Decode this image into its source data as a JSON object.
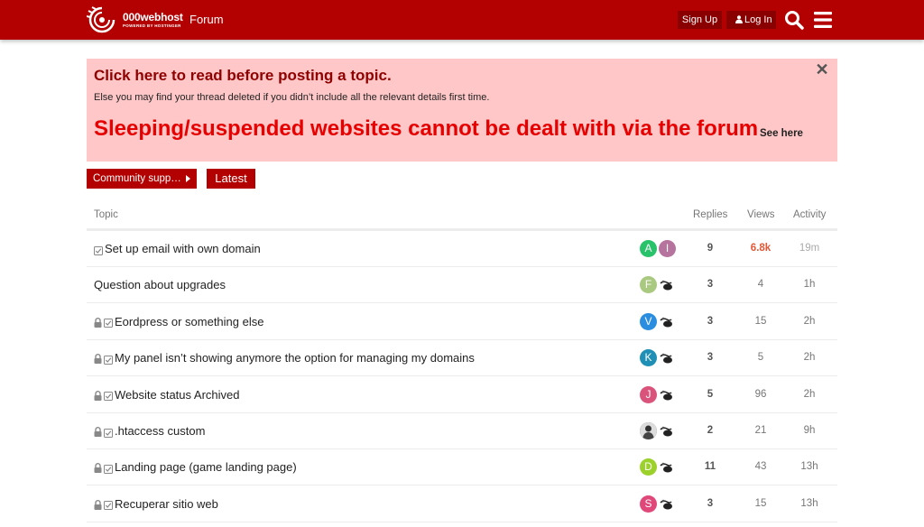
{
  "header": {
    "logo_name": "000webhost",
    "logo_tagline": "POWERED BY HOSTINGER",
    "forum_title": "Forum",
    "signup_label": "Sign Up",
    "login_label": "Log In",
    "brand_color": "#b30000"
  },
  "banner": {
    "title": "Click here to read before posting a topic.",
    "subtitle": "Else you may find your thread deleted if you didn’t include all the relevant details first time.",
    "headline": "Sleeping/suspended websites cannot be dealt with via the forum",
    "link": "See here",
    "close": "✕",
    "background": "#ffc7c7"
  },
  "filters": {
    "category": "Community supp…",
    "latest": "Latest"
  },
  "table": {
    "columns": [
      "Topic",
      "Replies",
      "Views",
      "Activity"
    ],
    "rows": [
      {
        "title": "Set up email with own domain",
        "locked": false,
        "solved": true,
        "avatars": [
          {
            "letter": "A",
            "color": "#27c26a"
          },
          {
            "letter": "I",
            "color": "#b5739d"
          }
        ],
        "replies": "9",
        "views": "6.8k",
        "activity": "19m",
        "hot": true
      },
      {
        "title": "Question about upgrades",
        "locked": false,
        "solved": false,
        "avatars": [
          {
            "letter": "F",
            "color": "#a8c97f"
          }
        ],
        "replies": "3",
        "views": "4",
        "activity": "1h",
        "hot": false
      },
      {
        "title": "Eordpress or something else",
        "locked": true,
        "solved": true,
        "avatars": [
          {
            "letter": "V",
            "color": "#2b8de0"
          }
        ],
        "replies": "3",
        "views": "15",
        "activity": "2h",
        "hot": false
      },
      {
        "title": "My panel isn’t showing anymore the option for managing my domains",
        "locked": true,
        "solved": true,
        "avatars": [
          {
            "letter": "K",
            "color": "#1f8fb5"
          }
        ],
        "replies": "3",
        "views": "5",
        "activity": "2h",
        "hot": false
      },
      {
        "title": "Website status Archived",
        "locked": true,
        "solved": true,
        "avatars": [
          {
            "letter": "J",
            "color": "#d9537a"
          }
        ],
        "replies": "5",
        "views": "96",
        "activity": "2h",
        "hot": false
      },
      {
        "title": ".htaccess custom",
        "locked": true,
        "solved": true,
        "avatars": [
          {
            "letter": "",
            "color": "#444444"
          }
        ],
        "replies": "2",
        "views": "21",
        "activity": "9h",
        "hot": false
      },
      {
        "title": "Landing page (game landing page)",
        "locked": true,
        "solved": true,
        "avatars": [
          {
            "letter": "D",
            "color": "#9bd12a"
          }
        ],
        "replies": "11",
        "views": "43",
        "activity": "13h",
        "hot": false
      },
      {
        "title": "Recuperar sitio web",
        "locked": true,
        "solved": true,
        "avatars": [
          {
            "letter": "S",
            "color": "#e0487a"
          }
        ],
        "replies": "3",
        "views": "15",
        "activity": "13h",
        "hot": false
      }
    ]
  }
}
